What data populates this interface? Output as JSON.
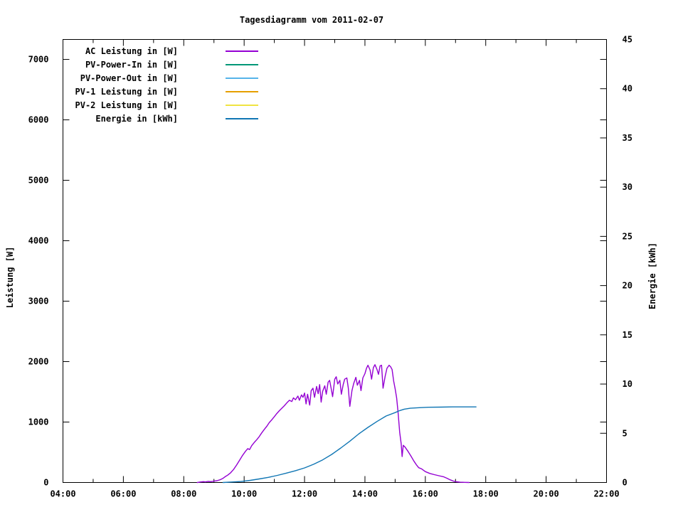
{
  "chart_data": {
    "type": "line",
    "title": "Tagesdiagramm vom 2011-02-07",
    "background_color": "#ffffff",
    "grid": false,
    "legend_position": "top-left-inside",
    "x_axis": {
      "min": 4,
      "max": 22,
      "major_ticks": [
        {
          "hour": 4,
          "label": "04:00"
        },
        {
          "hour": 6,
          "label": "06:00"
        },
        {
          "hour": 8,
          "label": "08:00"
        },
        {
          "hour": 10,
          "label": "10:00"
        },
        {
          "hour": 12,
          "label": "12:00"
        },
        {
          "hour": 14,
          "label": "14:00"
        },
        {
          "hour": 16,
          "label": "16:00"
        },
        {
          "hour": 18,
          "label": "18:00"
        },
        {
          "hour": 20,
          "label": "20:00"
        },
        {
          "hour": 22,
          "label": "22:00"
        }
      ],
      "minor_hours": [
        5,
        7,
        9,
        11,
        13,
        15,
        17,
        19,
        21
      ]
    },
    "y_left_axis": {
      "title": "Leistung [W]",
      "ticks": [
        0,
        1000,
        2000,
        3000,
        4000,
        5000,
        6000,
        7000
      ],
      "range": [
        0,
        7330
      ]
    },
    "y_right_axis": {
      "title": "Energie [kWh]",
      "ticks": [
        0,
        5,
        10,
        15,
        20,
        25,
        30,
        35,
        40,
        45
      ],
      "range": [
        0,
        45
      ]
    },
    "series": [
      {
        "id": "ac",
        "name": "AC Leistung in [W]",
        "color": "#9400D3",
        "axis": "left",
        "points": [
          [
            8.45,
            0
          ],
          [
            8.55,
            8
          ],
          [
            8.65,
            14
          ],
          [
            8.72,
            10
          ],
          [
            8.8,
            18
          ],
          [
            8.9,
            14
          ],
          [
            9.0,
            22
          ],
          [
            9.1,
            30
          ],
          [
            9.2,
            45
          ],
          [
            9.3,
            70
          ],
          [
            9.37,
            95
          ],
          [
            9.45,
            120
          ],
          [
            9.55,
            160
          ],
          [
            9.65,
            215
          ],
          [
            9.75,
            290
          ],
          [
            9.85,
            370
          ],
          [
            9.95,
            450
          ],
          [
            10.05,
            520
          ],
          [
            10.12,
            560
          ],
          [
            10.18,
            545
          ],
          [
            10.25,
            610
          ],
          [
            10.33,
            660
          ],
          [
            10.42,
            710
          ],
          [
            10.5,
            760
          ],
          [
            10.58,
            820
          ],
          [
            10.67,
            880
          ],
          [
            10.75,
            930
          ],
          [
            10.83,
            990
          ],
          [
            10.92,
            1040
          ],
          [
            11.0,
            1090
          ],
          [
            11.08,
            1140
          ],
          [
            11.17,
            1190
          ],
          [
            11.25,
            1230
          ],
          [
            11.33,
            1270
          ],
          [
            11.42,
            1320
          ],
          [
            11.5,
            1360
          ],
          [
            11.58,
            1340
          ],
          [
            11.63,
            1400
          ],
          [
            11.7,
            1370
          ],
          [
            11.78,
            1430
          ],
          [
            11.83,
            1360
          ],
          [
            11.9,
            1450
          ],
          [
            11.95,
            1410
          ],
          [
            12.0,
            1480
          ],
          [
            12.05,
            1300
          ],
          [
            12.1,
            1460
          ],
          [
            12.17,
            1280
          ],
          [
            12.22,
            1520
          ],
          [
            12.28,
            1560
          ],
          [
            12.33,
            1410
          ],
          [
            12.4,
            1590
          ],
          [
            12.45,
            1470
          ],
          [
            12.5,
            1620
          ],
          [
            12.55,
            1330
          ],
          [
            12.6,
            1510
          ],
          [
            12.67,
            1600
          ],
          [
            12.72,
            1460
          ],
          [
            12.78,
            1660
          ],
          [
            12.83,
            1690
          ],
          [
            12.88,
            1560
          ],
          [
            12.93,
            1420
          ],
          [
            13.0,
            1710
          ],
          [
            13.05,
            1750
          ],
          [
            13.1,
            1630
          ],
          [
            13.17,
            1690
          ],
          [
            13.22,
            1460
          ],
          [
            13.28,
            1620
          ],
          [
            13.33,
            1710
          ],
          [
            13.4,
            1730
          ],
          [
            13.45,
            1560
          ],
          [
            13.5,
            1260
          ],
          [
            13.57,
            1520
          ],
          [
            13.63,
            1640
          ],
          [
            13.7,
            1740
          ],
          [
            13.75,
            1610
          ],
          [
            13.82,
            1690
          ],
          [
            13.87,
            1520
          ],
          [
            13.93,
            1730
          ],
          [
            14.0,
            1800
          ],
          [
            14.05,
            1890
          ],
          [
            14.1,
            1940
          ],
          [
            14.17,
            1860
          ],
          [
            14.22,
            1710
          ],
          [
            14.28,
            1900
          ],
          [
            14.33,
            1950
          ],
          [
            14.4,
            1870
          ],
          [
            14.45,
            1790
          ],
          [
            14.5,
            1930
          ],
          [
            14.55,
            1940
          ],
          [
            14.6,
            1560
          ],
          [
            14.67,
            1760
          ],
          [
            14.73,
            1890
          ],
          [
            14.8,
            1940
          ],
          [
            14.85,
            1915
          ],
          [
            14.9,
            1870
          ],
          [
            14.95,
            1680
          ],
          [
            15.0,
            1550
          ],
          [
            15.05,
            1400
          ],
          [
            15.1,
            1150
          ],
          [
            15.15,
            830
          ],
          [
            15.2,
            640
          ],
          [
            15.23,
            430
          ],
          [
            15.27,
            615
          ],
          [
            15.33,
            585
          ],
          [
            15.42,
            520
          ],
          [
            15.52,
            440
          ],
          [
            15.62,
            355
          ],
          [
            15.7,
            295
          ],
          [
            15.78,
            245
          ],
          [
            15.88,
            225
          ],
          [
            16.0,
            180
          ],
          [
            16.15,
            150
          ],
          [
            16.3,
            130
          ],
          [
            16.45,
            112
          ],
          [
            16.6,
            95
          ],
          [
            16.72,
            70
          ],
          [
            16.82,
            45
          ],
          [
            16.92,
            25
          ],
          [
            17.02,
            12
          ],
          [
            17.15,
            5
          ],
          [
            17.3,
            2
          ],
          [
            17.45,
            0
          ]
        ]
      },
      {
        "id": "pv_in",
        "name": "PV-Power-In in [W]",
        "color": "#009778",
        "axis": "left",
        "points": []
      },
      {
        "id": "pv_out",
        "name": "PV-Power-Out in [W]",
        "color": "#56B4E9",
        "axis": "left",
        "points": []
      },
      {
        "id": "pv1",
        "name": "PV-1 Leistung in [W]",
        "color": "#E69F00",
        "axis": "left",
        "points": []
      },
      {
        "id": "pv2",
        "name": "PV-2 Leistung in [W]",
        "color": "#F0E442",
        "axis": "left",
        "points": []
      },
      {
        "id": "energie",
        "name": "Energie in [kWh]",
        "color": "#1076B4",
        "axis": "right",
        "points": [
          [
            9.3,
            0
          ],
          [
            9.6,
            0.05
          ],
          [
            9.9,
            0.1
          ],
          [
            10.2,
            0.22
          ],
          [
            10.5,
            0.36
          ],
          [
            10.8,
            0.52
          ],
          [
            11.1,
            0.72
          ],
          [
            11.4,
            0.95
          ],
          [
            11.7,
            1.2
          ],
          [
            12.0,
            1.48
          ],
          [
            12.3,
            1.85
          ],
          [
            12.6,
            2.3
          ],
          [
            12.9,
            2.85
          ],
          [
            13.2,
            3.5
          ],
          [
            13.5,
            4.2
          ],
          [
            13.8,
            4.95
          ],
          [
            14.1,
            5.6
          ],
          [
            14.4,
            6.2
          ],
          [
            14.7,
            6.75
          ],
          [
            15.0,
            7.1
          ],
          [
            15.15,
            7.3
          ],
          [
            15.3,
            7.45
          ],
          [
            15.5,
            7.54
          ],
          [
            15.8,
            7.6
          ],
          [
            16.1,
            7.64
          ],
          [
            16.5,
            7.66
          ],
          [
            16.9,
            7.68
          ],
          [
            17.3,
            7.68
          ],
          [
            17.68,
            7.68
          ]
        ]
      }
    ]
  }
}
